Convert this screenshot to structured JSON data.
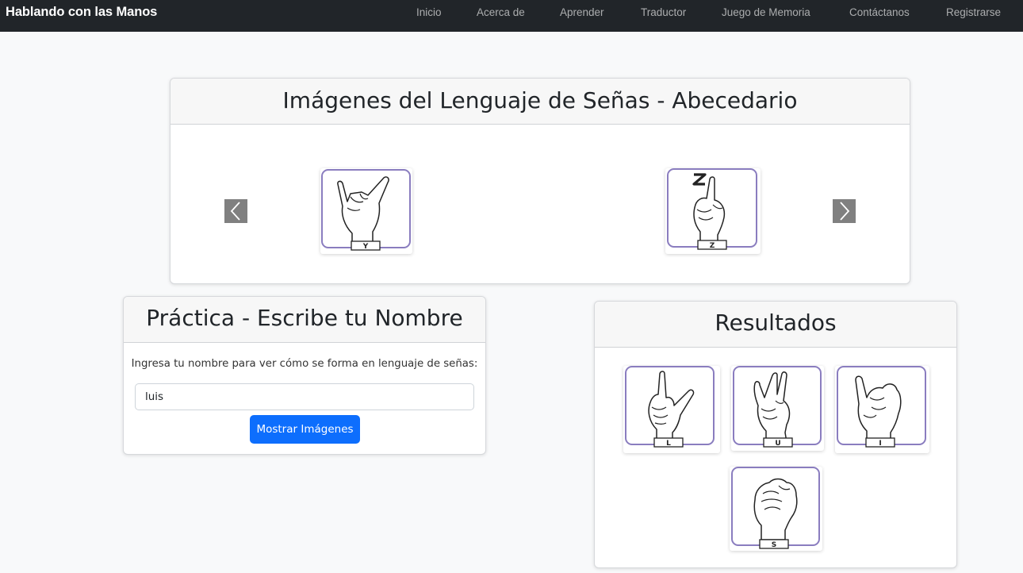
{
  "navbar": {
    "brand": "Hablando con las Manos",
    "links": [
      "Inicio",
      "Acerca de",
      "Aprender",
      "Traductor",
      "Juego de Memoria",
      "Contáctanos",
      "Registrarse"
    ]
  },
  "carousel": {
    "title": "Imágenes del Lenguaje de Señas - Abecedario",
    "slides": [
      {
        "letter": "Y"
      },
      {
        "letter": "Z"
      }
    ]
  },
  "practice": {
    "title": "Práctica - Escribe tu Nombre",
    "instruction": "Ingresa tu nombre para ver cómo se forma en lenguaje de señas:",
    "input_value": "luis",
    "button_label": "Mostrar Imágenes"
  },
  "results": {
    "title": "Resultados",
    "signs": [
      {
        "letter": "L"
      },
      {
        "letter": "U"
      },
      {
        "letter": "I"
      },
      {
        "letter": "S"
      }
    ]
  },
  "colors": {
    "navbar_bg": "#212529",
    "page_bg": "#f8f9fa",
    "primary": "#0d6efd",
    "tile_border": "#8a7dbf",
    "arrow_bg": "#808080"
  }
}
